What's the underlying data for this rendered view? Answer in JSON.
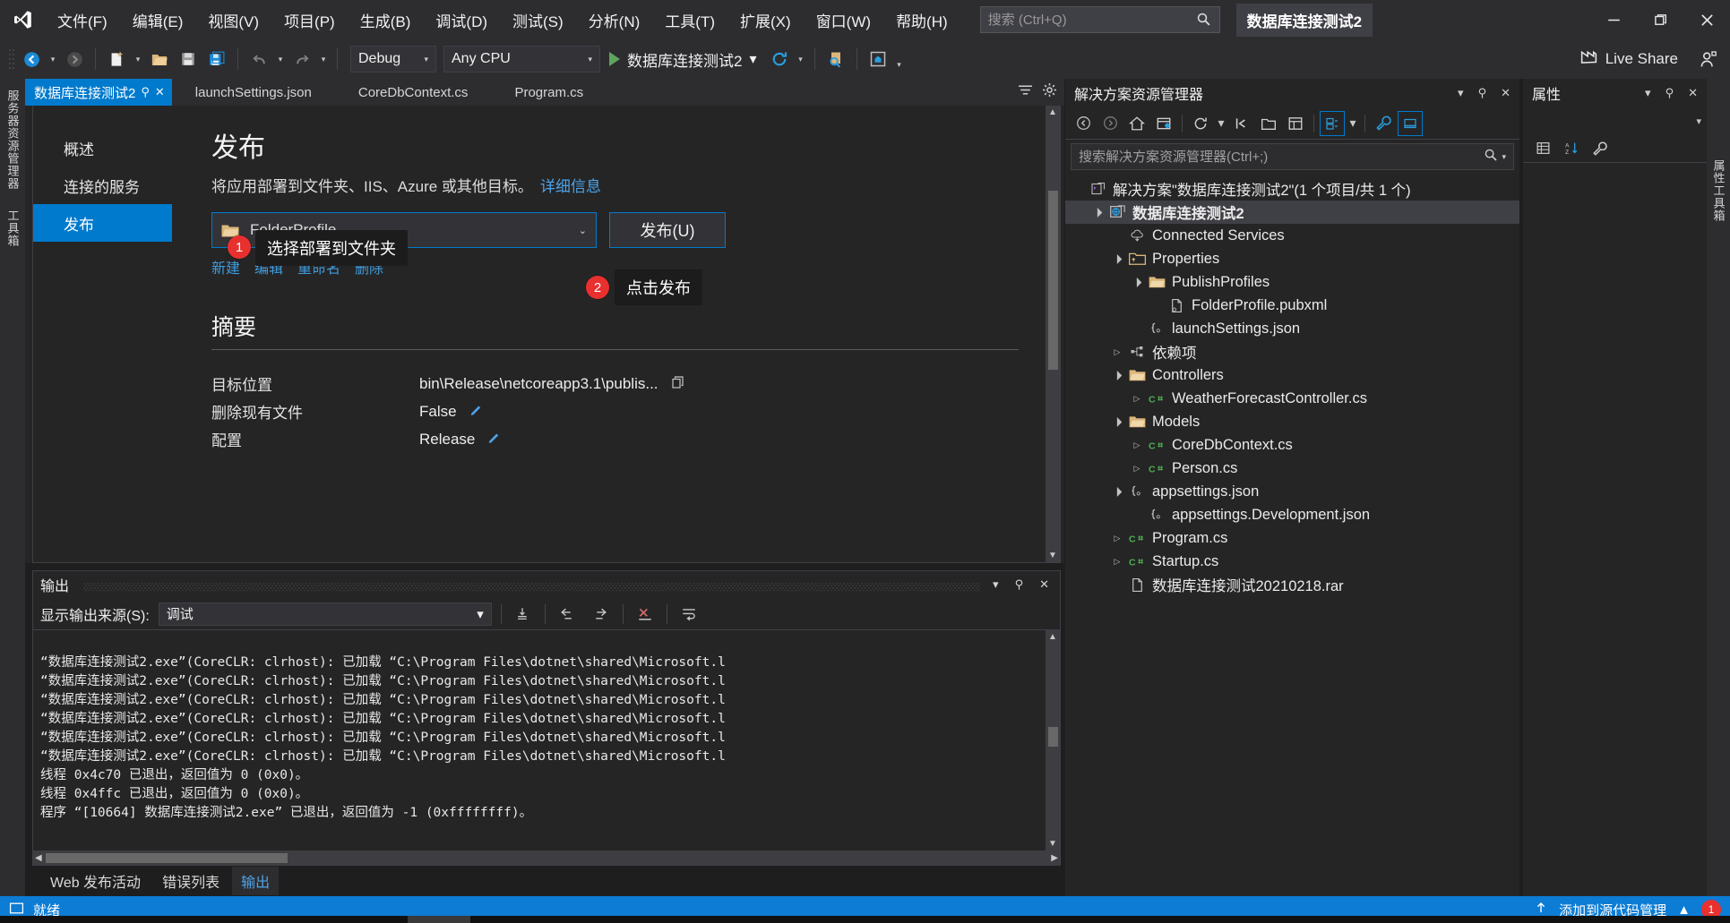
{
  "titlebar": {
    "menu": [
      "文件(F)",
      "编辑(E)",
      "视图(V)",
      "项目(P)",
      "生成(B)",
      "调试(D)",
      "测试(S)",
      "分析(N)",
      "工具(T)",
      "扩展(X)",
      "窗口(W)",
      "帮助(H)"
    ],
    "search_placeholder": "搜索 (Ctrl+Q)",
    "solution_chip": "数据库连接测试2",
    "minimize": "—",
    "restore": "❐",
    "close": "✕"
  },
  "toolbar": {
    "config": "Debug",
    "platform": "Any CPU",
    "run_target": "数据库连接测试2",
    "live_share": "Live Share"
  },
  "tabs": [
    {
      "label": "数据库连接测试2",
      "active": true,
      "pin": "⚲",
      "close": "✕"
    },
    {
      "label": "launchSettings.json",
      "active": false
    },
    {
      "label": "CoreDbContext.cs",
      "active": false
    },
    {
      "label": "Program.cs",
      "active": false
    }
  ],
  "leftbar": {
    "server_explorer": "服务器资源管理器",
    "toolbox": "工具箱"
  },
  "rightbar": {
    "properties_vertical": "属性工具箱"
  },
  "publish": {
    "nav": [
      {
        "label": "概述",
        "active": false
      },
      {
        "label": "连接的服务",
        "active": false
      },
      {
        "label": "发布",
        "active": true
      }
    ],
    "title": "发布",
    "subtitle": "将应用部署到文件夹、IIS、Azure 或其他目标。",
    "subtitle_link": "详细信息",
    "profile_name": "FolderProfile",
    "publish_button": "发布(U)",
    "profile_links": [
      "新建",
      "编辑",
      "重命名",
      "删除"
    ],
    "summary_title": "摘要",
    "summary_rows": [
      {
        "key": "目标位置",
        "value": "bin\\Release\\netcoreapp3.1\\publis...",
        "action": "copy"
      },
      {
        "key": "删除现有文件",
        "value": "False",
        "action": "edit"
      },
      {
        "key": "配置",
        "value": "Release",
        "action": "edit"
      }
    ],
    "annotations": [
      {
        "number": "1",
        "text": "选择部署到文件夹"
      },
      {
        "number": "2",
        "text": "点击发布"
      }
    ]
  },
  "output": {
    "title": "输出",
    "source_label": "显示输出来源(S):",
    "source_value": "调试",
    "lines": [
      "“数据库连接测试2.exe”(CoreCLR: clrhost): 已加载 “C:\\Program Files\\dotnet\\shared\\Microsoft.l",
      "“数据库连接测试2.exe”(CoreCLR: clrhost): 已加载 “C:\\Program Files\\dotnet\\shared\\Microsoft.l",
      "“数据库连接测试2.exe”(CoreCLR: clrhost): 已加载 “C:\\Program Files\\dotnet\\shared\\Microsoft.l",
      "“数据库连接测试2.exe”(CoreCLR: clrhost): 已加载 “C:\\Program Files\\dotnet\\shared\\Microsoft.l",
      "“数据库连接测试2.exe”(CoreCLR: clrhost): 已加载 “C:\\Program Files\\dotnet\\shared\\Microsoft.l",
      "“数据库连接测试2.exe”(CoreCLR: clrhost): 已加载 “C:\\Program Files\\dotnet\\shared\\Microsoft.l",
      "线程 0x4c70 已退出，返回值为 0 (0x0)。",
      "线程 0x4ffc 已退出，返回值为 0 (0x0)。",
      "程序 “[10664] 数据库连接测试2.exe” 已退出，返回值为 -1 (0xffffffff)。"
    ],
    "bottom_tabs": [
      {
        "label": "Web 发布活动",
        "active": false
      },
      {
        "label": "错误列表",
        "active": false
      },
      {
        "label": "输出",
        "active": true
      }
    ]
  },
  "solution_explorer": {
    "title": "解决方案资源管理器",
    "search_placeholder": "搜索解决方案资源管理器(Ctrl+;)",
    "tree": [
      {
        "label": "解决方案\"数据库连接测试2\"(1 个项目/共 1 个)",
        "indent": 0,
        "twisty": "",
        "icon": "vs-solution-icon",
        "bold": false,
        "selected": false
      },
      {
        "label": "数据库连接测试2",
        "indent": 1,
        "twisty": "▲",
        "icon": "project-web-icon",
        "bold": true,
        "selected": true
      },
      {
        "label": "Connected Services",
        "indent": 2,
        "twisty": "",
        "icon": "connected-services-icon",
        "bold": false,
        "selected": false
      },
      {
        "label": "Properties",
        "indent": 2,
        "twisty": "▲",
        "icon": "properties-folder-icon",
        "bold": false,
        "selected": false
      },
      {
        "label": "PublishProfiles",
        "indent": 3,
        "twisty": "▲",
        "icon": "folder-icon",
        "bold": false,
        "selected": false
      },
      {
        "label": "FolderProfile.pubxml",
        "indent": 4,
        "twisty": "",
        "icon": "xml-file-icon",
        "bold": false,
        "selected": false
      },
      {
        "label": "launchSettings.json",
        "indent": 3,
        "twisty": "",
        "icon": "json-file-icon",
        "bold": false,
        "selected": false
      },
      {
        "label": "依赖项",
        "indent": 2,
        "twisty": "▶",
        "icon": "dependencies-icon",
        "bold": false,
        "selected": false
      },
      {
        "label": "Controllers",
        "indent": 2,
        "twisty": "▲",
        "icon": "folder-icon",
        "bold": false,
        "selected": false
      },
      {
        "label": "WeatherForecastController.cs",
        "indent": 3,
        "twisty": "▶",
        "icon": "csharp-file-icon",
        "bold": false,
        "selected": false
      },
      {
        "label": "Models",
        "indent": 2,
        "twisty": "▲",
        "icon": "folder-icon",
        "bold": false,
        "selected": false
      },
      {
        "label": "CoreDbContext.cs",
        "indent": 3,
        "twisty": "▶",
        "icon": "csharp-file-icon",
        "bold": false,
        "selected": false
      },
      {
        "label": "Person.cs",
        "indent": 3,
        "twisty": "▶",
        "icon": "csharp-file-icon",
        "bold": false,
        "selected": false
      },
      {
        "label": "appsettings.json",
        "indent": 2,
        "twisty": "▲",
        "icon": "json-file-icon",
        "bold": false,
        "selected": false
      },
      {
        "label": "appsettings.Development.json",
        "indent": 3,
        "twisty": "",
        "icon": "json-file-icon",
        "bold": false,
        "selected": false
      },
      {
        "label": "Program.cs",
        "indent": 2,
        "twisty": "▶",
        "icon": "csharp-file-icon",
        "bold": false,
        "selected": false
      },
      {
        "label": "Startup.cs",
        "indent": 2,
        "twisty": "▶",
        "icon": "csharp-file-icon",
        "bold": false,
        "selected": false
      },
      {
        "label": "数据库连接测试20210218.rar",
        "indent": 2,
        "twisty": "",
        "icon": "file-icon",
        "bold": false,
        "selected": false
      }
    ]
  },
  "properties_panel": {
    "title": "属性"
  },
  "statusbar": {
    "status": "就绪",
    "source_control": "添加到源代码管理",
    "notification_count": "1"
  },
  "colors": {
    "accent": "#007acc",
    "chrome": "#2d2d30",
    "panel": "#252526",
    "editor": "#1e1e1e",
    "status": "#0c7cd5",
    "badge_red": "#e8302f",
    "link": "#4ea3e8",
    "folder": "#dcb67a"
  }
}
